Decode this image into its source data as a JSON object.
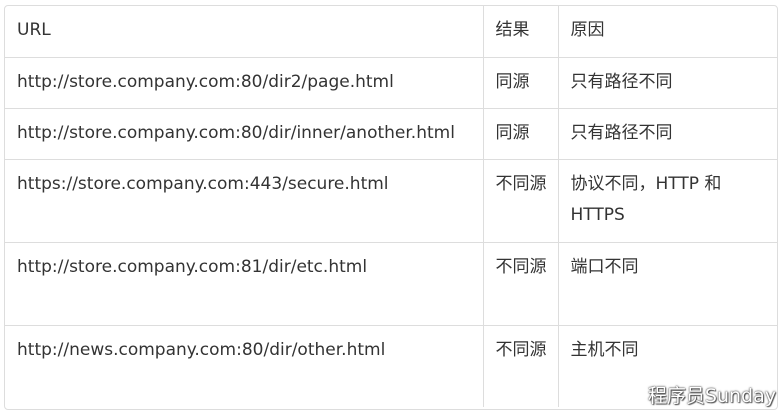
{
  "table": {
    "headers": [
      "URL",
      "结果",
      "原因"
    ],
    "rows": [
      {
        "url": "http://store.company.com:80/dir2/page.html",
        "result": "同源",
        "reason": "只有路径不同"
      },
      {
        "url": "http://store.company.com:80/dir/inner/another.html",
        "result": "同源",
        "reason": "只有路径不同"
      },
      {
        "url": "https://store.company.com:443/secure.html",
        "result": "不同源",
        "reason": "协议不同，HTTP 和 HTTPS"
      },
      {
        "url": "http://store.company.com:81/dir/etc.html",
        "result": "不同源",
        "reason": "端口不同"
      },
      {
        "url": "http://news.company.com:80/dir/other.html",
        "result": "不同源",
        "reason": "主机不同"
      }
    ]
  },
  "watermark": {
    "text": "程序员Sunday",
    "icon": "wechat-icon"
  }
}
